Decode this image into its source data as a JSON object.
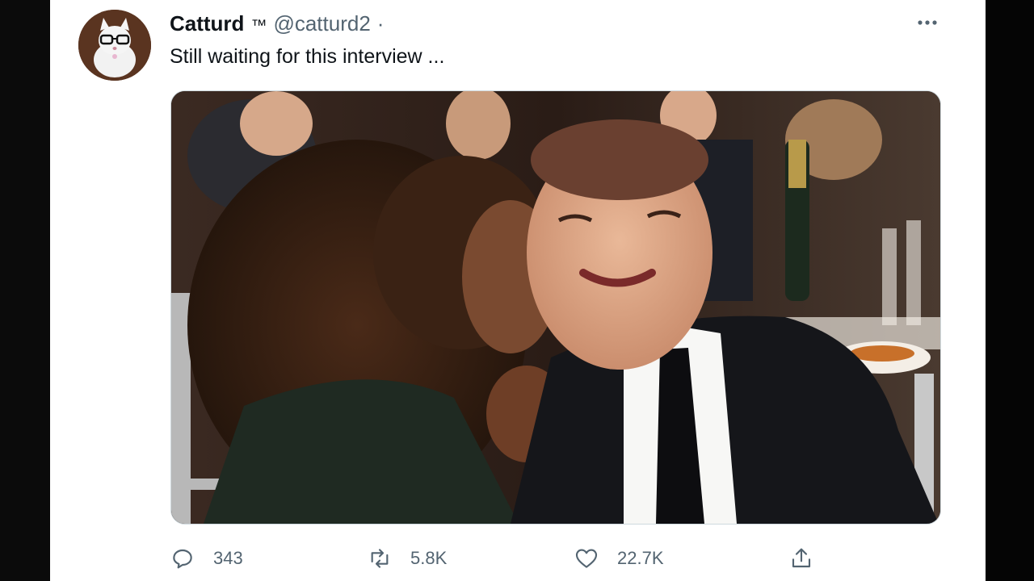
{
  "tweet": {
    "display_name": "Catturd",
    "trademark": "™",
    "handle": "@catturd2",
    "separator": "·",
    "text": "Still waiting for this interview ...",
    "more_icon": "more-horizontal-icon"
  },
  "media": {
    "type": "photo",
    "description_hidden": true
  },
  "actions": {
    "reply_count": "343",
    "retweet_count": "5.8K",
    "like_count": "22.7K",
    "reply_icon": "reply-icon",
    "retweet_icon": "retweet-icon",
    "like_icon": "heart-icon",
    "share_icon": "share-icon"
  },
  "colors": {
    "text_primary": "#0f1419",
    "text_secondary": "#536471",
    "border": "#cfd9de",
    "background": "#ffffff"
  }
}
